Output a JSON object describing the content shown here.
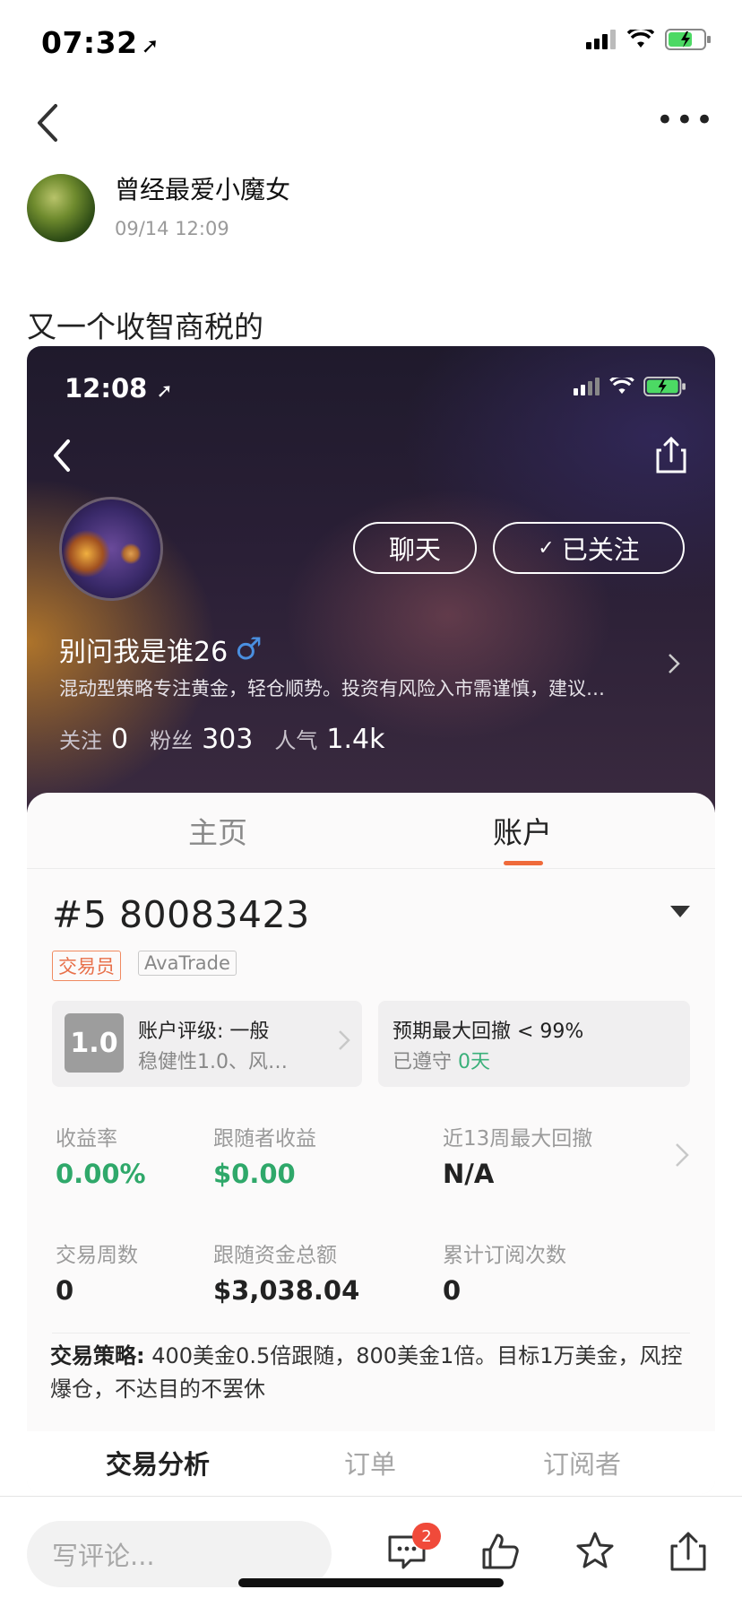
{
  "status_bar": {
    "time": "07:32"
  },
  "post": {
    "author": "曾经最爱小魔女",
    "time": "09/14 12:09",
    "text": "又一个收智商税的"
  },
  "screenshot": {
    "status_time": "12:08",
    "profile": {
      "chat_label": "聊天",
      "follow_label": "已关注",
      "name": "别问我是谁26",
      "gender_symbol": "♂",
      "bio": "混动型策略专注黄金，轻仓顺势。投资有风险入市需谨慎，建议…",
      "stats": [
        {
          "label": "关注",
          "value": "0"
        },
        {
          "label": "粉丝",
          "value": "303"
        },
        {
          "label": "人气",
          "value": "1.4k"
        }
      ]
    },
    "tabs": [
      "主页",
      "账户"
    ],
    "active_tab": "账户",
    "account": {
      "number": "#5 80083423",
      "tags": [
        "交易员",
        "AvaTrade"
      ],
      "rating_badge": "1.0",
      "rating_title": "账户评级: 一般",
      "rating_detail": "稳健性1.0、风…",
      "drawdown_title": "预期最大回撤 < 99%",
      "compliance_label": "已遵守",
      "compliance_value": "0天"
    },
    "metrics": [
      {
        "label": "收益率",
        "value": "0.00%"
      },
      {
        "label": "跟随者收益",
        "value": "$0.00"
      },
      {
        "label": "近13周最大回撤",
        "value": "N/A"
      },
      {
        "label": "交易周数",
        "value": "0"
      },
      {
        "label": "跟随资金总额",
        "value": "$3,038.04"
      },
      {
        "label": "累计订阅次数",
        "value": "0"
      }
    ],
    "strategy_label": "交易策略:",
    "strategy_text": " 400美金0.5倍跟随，800美金1倍。目标1万美金，风控爆仓，不达目的不罢休",
    "bottom_tabs": [
      "交易分析",
      "订单",
      "订阅者"
    ]
  },
  "bottom_bar": {
    "comment_placeholder": "写评论...",
    "comment_badge": "2"
  },
  "colors": {
    "accent": "#ef6a3a",
    "positive": "#2fa86a",
    "badge": "#f04a3a"
  }
}
